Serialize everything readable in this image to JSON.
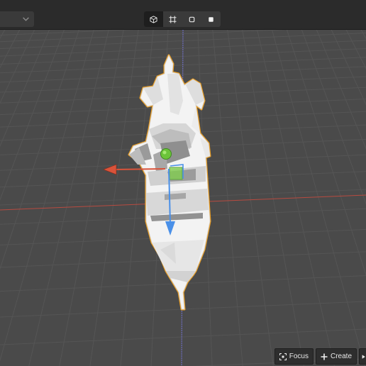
{
  "toolbar": {
    "mode_dropdown": {
      "value": "",
      "icon": "chevron-down-icon"
    },
    "shading_modes": [
      {
        "name": "solid-cube-icon",
        "active": true
      },
      {
        "name": "wireframe-icon",
        "active": false
      },
      {
        "name": "outline-square-icon",
        "active": false
      },
      {
        "name": "filled-square-icon",
        "active": false
      }
    ]
  },
  "viewport": {
    "gizmo": {
      "x_axis_color": "#d9533a",
      "y_axis_color": "#4a90e8",
      "center_color": "#6cc43a",
      "plane_color": "#7fd04a"
    },
    "selection_outline_color": "#f0a020",
    "grid_x_axis_color": "#b84a40",
    "grid_y_axis_color": "#6e6ecc"
  },
  "bottom_actions": {
    "focus_label": "Focus",
    "create_label": "Create"
  }
}
